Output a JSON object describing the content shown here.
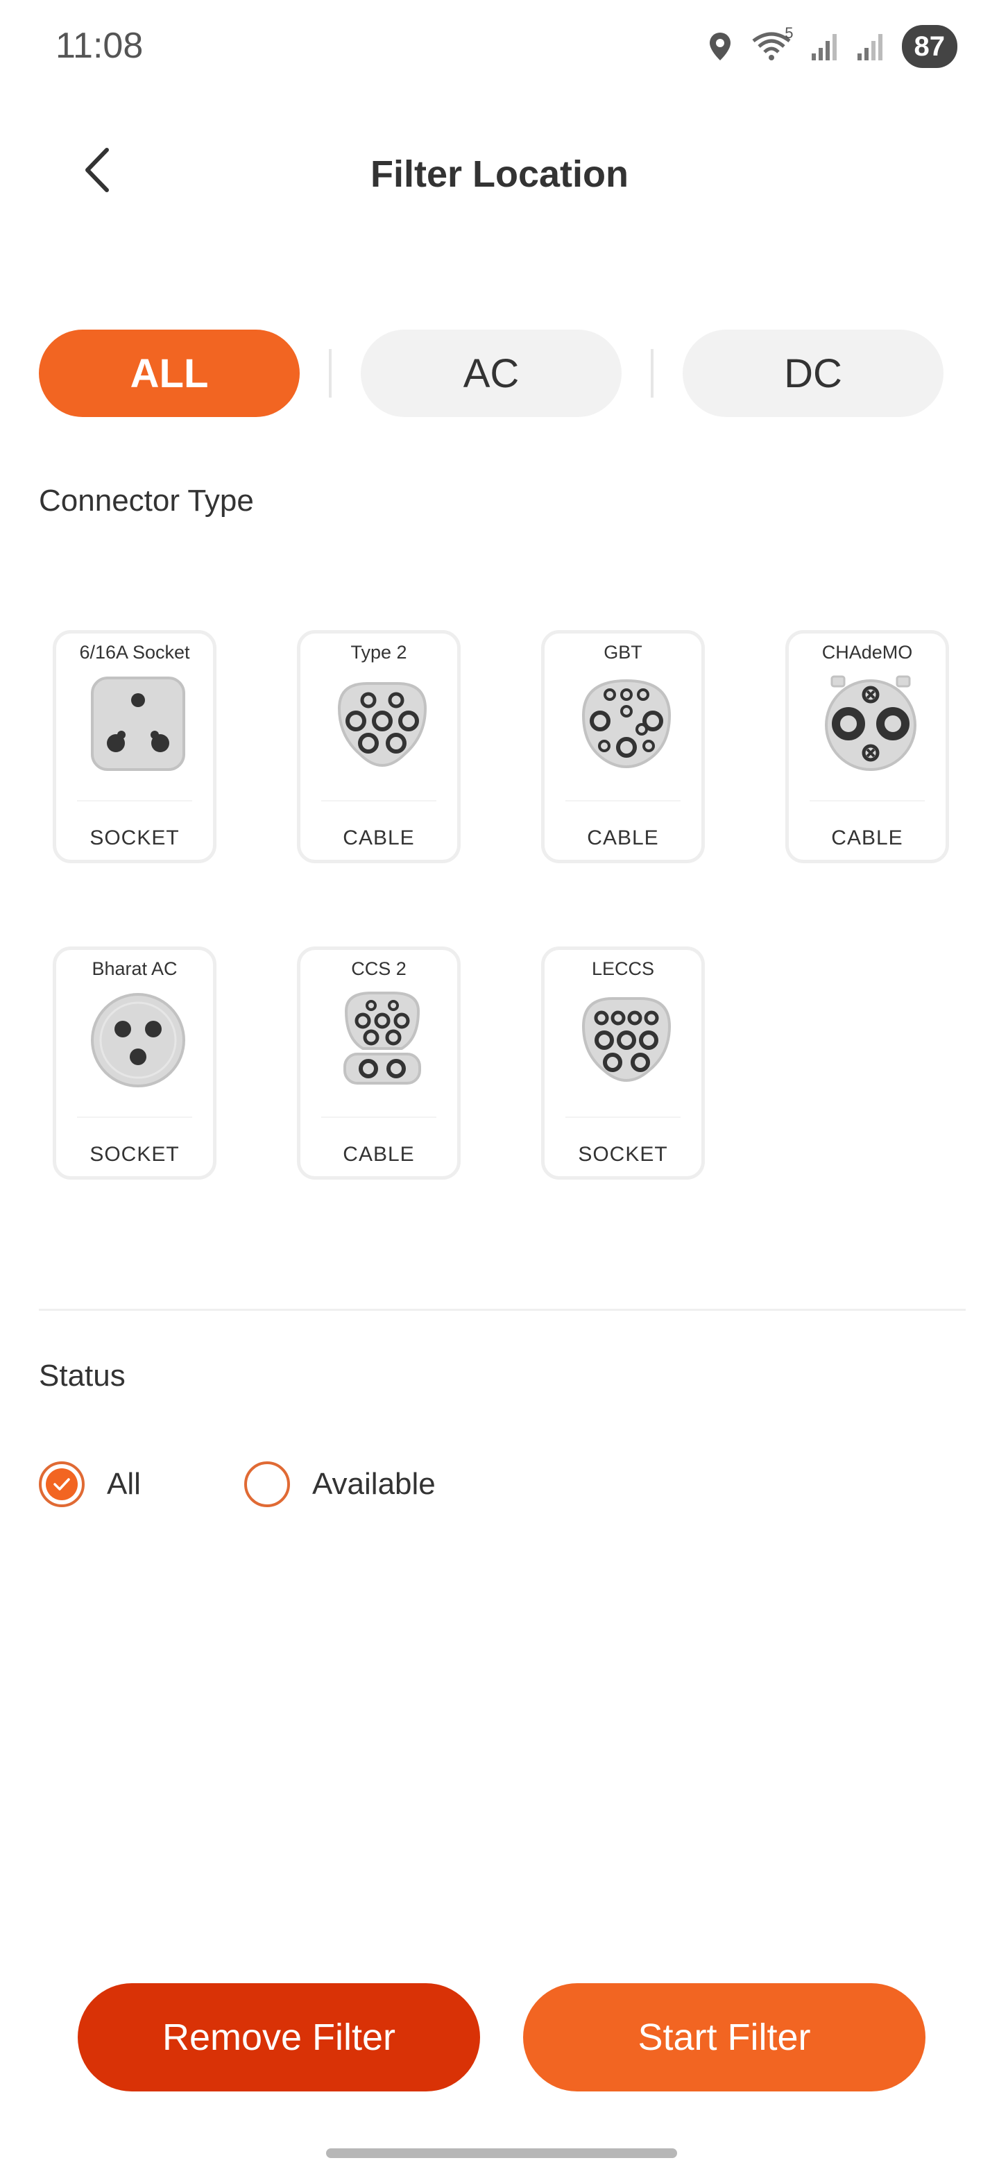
{
  "status_bar": {
    "time": "11:08",
    "battery": "87",
    "signal_badge": "5"
  },
  "header": {
    "title": "Filter Location"
  },
  "tabs": [
    {
      "label": "ALL",
      "active": true
    },
    {
      "label": "AC",
      "active": false
    },
    {
      "label": "DC",
      "active": false
    }
  ],
  "connector_section": {
    "title": "Connector Type"
  },
  "connectors": [
    {
      "name": "6/16A Socket",
      "kind": "SOCKET",
      "icon": "socket-616a-icon"
    },
    {
      "name": "Type 2",
      "kind": "CABLE",
      "icon": "type2-plug-icon"
    },
    {
      "name": "GBT",
      "kind": "CABLE",
      "icon": "gbt-plug-icon"
    },
    {
      "name": "CHAdeMO",
      "kind": "CABLE",
      "icon": "chademo-plug-icon"
    },
    {
      "name": "Bharat AC",
      "kind": "SOCKET",
      "icon": "bharat-ac-plug-icon"
    },
    {
      "name": "CCS 2",
      "kind": "CABLE",
      "icon": "ccs2-plug-icon"
    },
    {
      "name": "LECCS",
      "kind": "SOCKET",
      "icon": "leccs-plug-icon"
    }
  ],
  "status_section": {
    "title": "Status",
    "options": [
      {
        "label": "All",
        "selected": true
      },
      {
        "label": "Available",
        "selected": false
      }
    ]
  },
  "buttons": {
    "remove": "Remove Filter",
    "start": "Start Filter"
  },
  "colors": {
    "accent": "#f26522",
    "remove_button": "#d93206",
    "tab_inactive": "#f2f2f2"
  }
}
